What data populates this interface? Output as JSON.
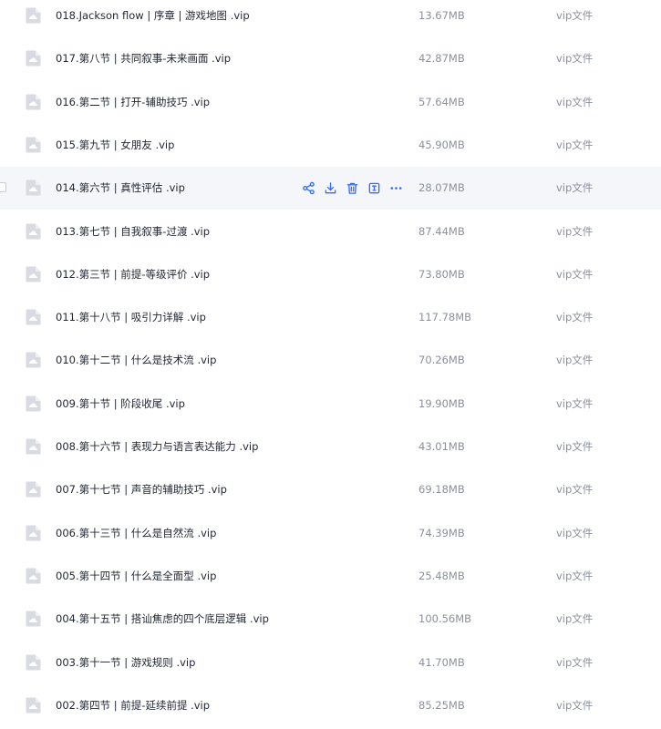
{
  "files": [
    {
      "name": "018.Jackson flow | 序章 | 游戏地图 .vip",
      "size": "13.67MB",
      "type": "vip文件"
    },
    {
      "name": "017.第八节 | 共同叙事-未来画面 .vip",
      "size": "42.87MB",
      "type": "vip文件"
    },
    {
      "name": "016.第二节 | 打开-辅助技巧 .vip",
      "size": "57.64MB",
      "type": "vip文件"
    },
    {
      "name": "015.第九节 | 女朋友 .vip",
      "size": "45.90MB",
      "type": "vip文件"
    },
    {
      "name": "014.第六节 | 真性评估 .vip",
      "size": "28.07MB",
      "type": "vip文件"
    },
    {
      "name": "013.第七节 | 自我叙事-过渡 .vip",
      "size": "87.44MB",
      "type": "vip文件"
    },
    {
      "name": "012.第三节 | 前提-等级评价 .vip",
      "size": "73.80MB",
      "type": "vip文件"
    },
    {
      "name": "011.第十八节 | 吸引力详解 .vip",
      "size": "117.78MB",
      "type": "vip文件"
    },
    {
      "name": "010.第十二节 | 什么是技术流 .vip",
      "size": "70.26MB",
      "type": "vip文件"
    },
    {
      "name": "009.第十节 | 阶段收尾 .vip",
      "size": "19.90MB",
      "type": "vip文件"
    },
    {
      "name": "008.第十六节 | 表现力与语言表达能力 .vip",
      "size": "43.01MB",
      "type": "vip文件"
    },
    {
      "name": "007.第十七节 | 声音的辅助技巧 .vip",
      "size": "69.18MB",
      "type": "vip文件"
    },
    {
      "name": "006.第十三节 | 什么是自然流 .vip",
      "size": "74.39MB",
      "type": "vip文件"
    },
    {
      "name": "005.第十四节 | 什么是全面型 .vip",
      "size": "25.48MB",
      "type": "vip文件"
    },
    {
      "name": "004.第十五节 | 搭讪焦虑的四个底层逻辑 .vip",
      "size": "100.56MB",
      "type": "vip文件"
    },
    {
      "name": "003.第十一节 | 游戏规则 .vip",
      "size": "41.70MB",
      "type": "vip文件"
    },
    {
      "name": "002.第四节 | 前提-延续前提 .vip",
      "size": "85.25MB",
      "type": "vip文件"
    }
  ],
  "hovered_row": 4,
  "row_actions": [
    {
      "icon": "share-icon",
      "action": "share"
    },
    {
      "icon": "download-icon",
      "action": "download"
    },
    {
      "icon": "delete-icon",
      "action": "delete"
    },
    {
      "icon": "rename-icon",
      "action": "rename"
    },
    {
      "icon": "more-icon",
      "action": "more"
    }
  ],
  "colors": {
    "accent": "#2f6bff",
    "text": "#1f2533",
    "muted": "#8b909e",
    "hover_bg": "#f5f6fa",
    "icon_fill": "#d8dbe2"
  }
}
